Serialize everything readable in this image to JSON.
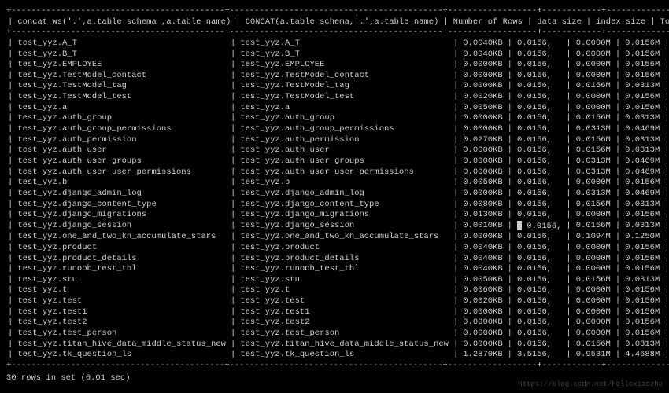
{
  "headers": {
    "col1": "concat_ws('.',a.table_schema ,a.table_name)",
    "col2": "CONCAT(a.table_schema,'.',a.table_name)",
    "col3": "Number of Rows",
    "col4": "data_size",
    "col5": "index_size",
    "col6": "Total"
  },
  "rows": [
    {
      "c1": "test_yyz.A_T",
      "c2": "test_yyz.A_T",
      "c3": "0.0040KB",
      "c4": "0.0156,",
      "c5": "0.0000M",
      "c6": "0.0156M"
    },
    {
      "c1": "test_yyz.B_T",
      "c2": "test_yyz.B_T",
      "c3": "0.0040KB",
      "c4": "0.0156,",
      "c5": "0.0000M",
      "c6": "0.0156M"
    },
    {
      "c1": "test_yyz.EMPLOYEE",
      "c2": "test_yyz.EMPLOYEE",
      "c3": "0.0000KB",
      "c4": "0.0156,",
      "c5": "0.0000M",
      "c6": "0.0156M"
    },
    {
      "c1": "test_yyz.TestModel_contact",
      "c2": "test_yyz.TestModel_contact",
      "c3": "0.0000KB",
      "c4": "0.0156,",
      "c5": "0.0000M",
      "c6": "0.0156M"
    },
    {
      "c1": "test_yyz.TestModel_tag",
      "c2": "test_yyz.TestModel_tag",
      "c3": "0.0000KB",
      "c4": "0.0156,",
      "c5": "0.0156M",
      "c6": "0.0313M"
    },
    {
      "c1": "test_yyz.TestModel_test",
      "c2": "test_yyz.TestModel_test",
      "c3": "0.0020KB",
      "c4": "0.0156,",
      "c5": "0.0000M",
      "c6": "0.0156M"
    },
    {
      "c1": "test_yyz.a",
      "c2": "test_yyz.a",
      "c3": "0.0050KB",
      "c4": "0.0156,",
      "c5": "0.0000M",
      "c6": "0.0156M"
    },
    {
      "c1": "test_yyz.auth_group",
      "c2": "test_yyz.auth_group",
      "c3": "0.0000KB",
      "c4": "0.0156,",
      "c5": "0.0156M",
      "c6": "0.0313M"
    },
    {
      "c1": "test_yyz.auth_group_permissions",
      "c2": "test_yyz.auth_group_permissions",
      "c3": "0.0000KB",
      "c4": "0.0156,",
      "c5": "0.0313M",
      "c6": "0.0469M"
    },
    {
      "c1": "test_yyz.auth_permission",
      "c2": "test_yyz.auth_permission",
      "c3": "0.0270KB",
      "c4": "0.0156,",
      "c5": "0.0156M",
      "c6": "0.0313M"
    },
    {
      "c1": "test_yyz.auth_user",
      "c2": "test_yyz.auth_user",
      "c3": "0.0000KB",
      "c4": "0.0156,",
      "c5": "0.0156M",
      "c6": "0.0313M"
    },
    {
      "c1": "test_yyz.auth_user_groups",
      "c2": "test_yyz.auth_user_groups",
      "c3": "0.0000KB",
      "c4": "0.0156,",
      "c5": "0.0313M",
      "c6": "0.0469M"
    },
    {
      "c1": "test_yyz.auth_user_user_permissions",
      "c2": "test_yyz.auth_user_user_permissions",
      "c3": "0.0000KB",
      "c4": "0.0156,",
      "c5": "0.0313M",
      "c6": "0.0469M"
    },
    {
      "c1": "test_yyz.b",
      "c2": "test_yyz.b",
      "c3": "0.0050KB",
      "c4": "0.0156,",
      "c5": "0.0000M",
      "c6": "0.0156M"
    },
    {
      "c1": "test_yyz.django_admin_log",
      "c2": "test_yyz.django_admin_log",
      "c3": "0.0000KB",
      "c4": "0.0156,",
      "c5": "0.0313M",
      "c6": "0.0469M"
    },
    {
      "c1": "test_yyz.django_content_type",
      "c2": "test_yyz.django_content_type",
      "c3": "0.0080KB",
      "c4": "0.0156,",
      "c5": "0.0156M",
      "c6": "0.0313M"
    },
    {
      "c1": "test_yyz.django_migrations",
      "c2": "test_yyz.django_migrations",
      "c3": "0.0130KB",
      "c4": "0.0156,",
      "c5": "0.0000M",
      "c6": "0.0156M"
    },
    {
      "c1": "test_yyz.django_session",
      "c2": "test_yyz.django_session",
      "c3": "0.0010KB",
      "c4": "0.0156,",
      "c5": "0.0156M",
      "c6": "0.0313M",
      "cursor": true
    },
    {
      "c1": "test_yyz.one_and_two_kn_accumulate_stars",
      "c2": "test_yyz.one_and_two_kn_accumulate_stars",
      "c3": "0.0000KB",
      "c4": "0.0156,",
      "c5": "0.1094M",
      "c6": "0.1250M"
    },
    {
      "c1": "test_yyz.product",
      "c2": "test_yyz.product",
      "c3": "0.0040KB",
      "c4": "0.0156,",
      "c5": "0.0000M",
      "c6": "0.0156M"
    },
    {
      "c1": "test_yyz.product_details",
      "c2": "test_yyz.product_details",
      "c3": "0.0040KB",
      "c4": "0.0156,",
      "c5": "0.0000M",
      "c6": "0.0156M"
    },
    {
      "c1": "test_yyz.runoob_test_tbl",
      "c2": "test_yyz.runoob_test_tbl",
      "c3": "0.0040KB",
      "c4": "0.0156,",
      "c5": "0.0000M",
      "c6": "0.0156M"
    },
    {
      "c1": "test_yyz.stu",
      "c2": "test_yyz.stu",
      "c3": "0.0050KB",
      "c4": "0.0156,",
      "c5": "0.0156M",
      "c6": "0.0313M"
    },
    {
      "c1": "test_yyz.t",
      "c2": "test_yyz.t",
      "c3": "0.0060KB",
      "c4": "0.0156,",
      "c5": "0.0000M",
      "c6": "0.0156M"
    },
    {
      "c1": "test_yyz.test",
      "c2": "test_yyz.test",
      "c3": "0.0020KB",
      "c4": "0.0156,",
      "c5": "0.0000M",
      "c6": "0.0156M"
    },
    {
      "c1": "test_yyz.test1",
      "c2": "test_yyz.test1",
      "c3": "0.0000KB",
      "c4": "0.0156,",
      "c5": "0.0000M",
      "c6": "0.0156M"
    },
    {
      "c1": "test_yyz.test2",
      "c2": "test_yyz.test2",
      "c3": "0.0000KB",
      "c4": "0.0156,",
      "c5": "0.0000M",
      "c6": "0.0156M"
    },
    {
      "c1": "test_yyz.test_person",
      "c2": "test_yyz.test_person",
      "c3": "0.0000KB",
      "c4": "0.0156,",
      "c5": "0.0000M",
      "c6": "0.0156M"
    },
    {
      "c1": "test_yyz.titan_hive_data_middle_status_new",
      "c2": "test_yyz.titan_hive_data_middle_status_new",
      "c3": "0.0000KB",
      "c4": "0.0156,",
      "c5": "0.0156M",
      "c6": "0.0313M"
    },
    {
      "c1": "test_yyz.tk_question_ls",
      "c2": "test_yyz.tk_question_ls",
      "c3": "1.2870KB",
      "c4": "3.5156,",
      "c5": "0.9531M",
      "c6": "4.4688M"
    }
  ],
  "separator": "+-------------------------------------------+-------------------------------------------+------------------+------------+--------------+----------+",
  "footer": "30 rows in set (0.01 sec)",
  "watermark": "https://blog.csdn.net/helloxiaozhe"
}
